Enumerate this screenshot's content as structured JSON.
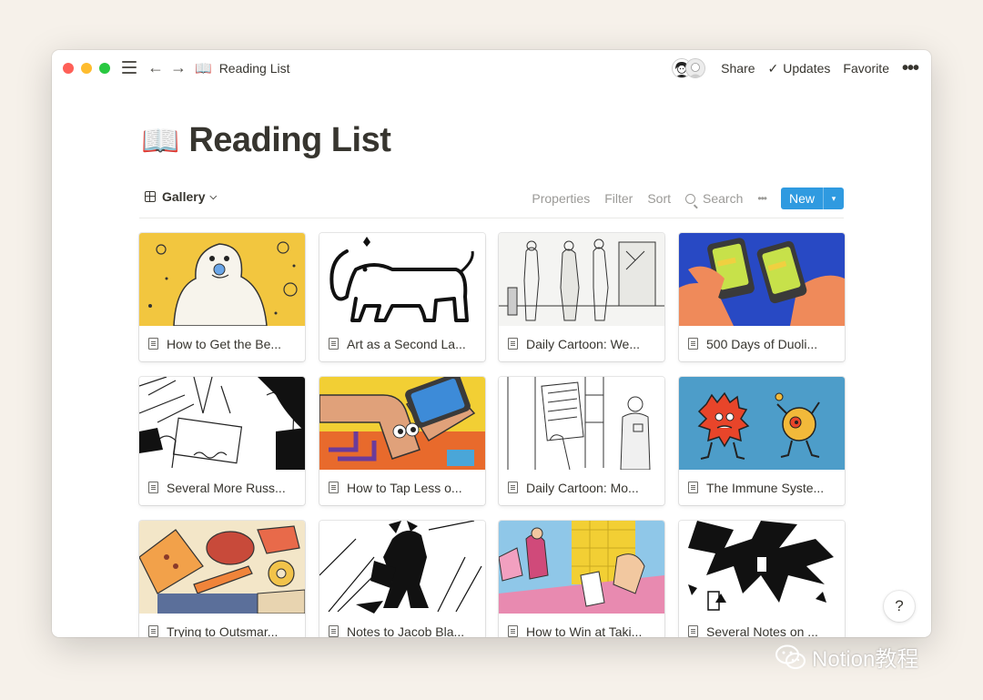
{
  "titlebar": {
    "breadcrumb_icon": "📖",
    "breadcrumb_label": "Reading List",
    "share_label": "Share",
    "updates_label": "Updates",
    "favorite_label": "Favorite",
    "more_label": "•••"
  },
  "page": {
    "icon": "📖",
    "title": "Reading List"
  },
  "viewbar": {
    "view_label": "Gallery",
    "properties_label": "Properties",
    "filter_label": "Filter",
    "sort_label": "Sort",
    "search_label": "Search",
    "more_label": "•••",
    "new_label": "New",
    "new_dropdown": "▾"
  },
  "cards": [
    {
      "title": "How to Get the Be..."
    },
    {
      "title": "Art as a Second La..."
    },
    {
      "title": "Daily Cartoon: We..."
    },
    {
      "title": "500 Days of Duoli..."
    },
    {
      "title": "Several More Russ..."
    },
    {
      "title": "How to Tap Less o..."
    },
    {
      "title": "Daily Cartoon: Mo..."
    },
    {
      "title": "The Immune Syste..."
    },
    {
      "title": "Trying to Outsmar..."
    },
    {
      "title": "Notes to Jacob Bla..."
    },
    {
      "title": "How to Win at Taki..."
    },
    {
      "title": "Several Notes on ..."
    }
  ],
  "help_label": "?",
  "watermark": "Notion教程",
  "colors": {
    "accent": "#2f9ae0",
    "background": "#f6f1ea",
    "text": "#37352f",
    "muted": "#9b9a97"
  },
  "icons": [
    "menu-icon",
    "back-arrow-icon",
    "forward-arrow-icon",
    "book-icon",
    "checkmark-icon",
    "more-icon",
    "gallery-grid-icon",
    "chevron-down-icon",
    "search-icon",
    "document-icon",
    "help-icon",
    "wechat-icon"
  ]
}
